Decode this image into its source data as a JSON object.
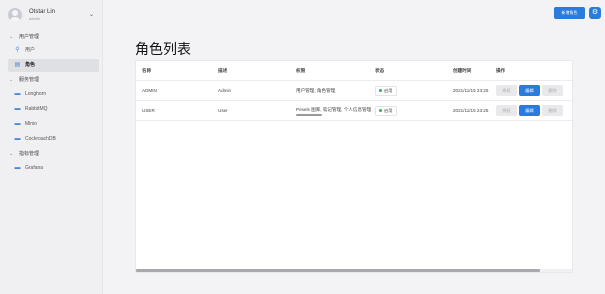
{
  "sidebar": {
    "user": {
      "name": "Otstar Lin",
      "role": "admin"
    },
    "groups": [
      {
        "label": "用户管理",
        "items": [
          {
            "label": "用户",
            "active": false
          },
          {
            "label": "角色",
            "active": true
          }
        ]
      },
      {
        "label": "服务管理",
        "items": [
          {
            "label": "Longhorn"
          },
          {
            "label": "RabbitMQ"
          },
          {
            "label": "Minio"
          },
          {
            "label": "CockroachDB"
          }
        ]
      },
      {
        "label": "指标管理",
        "items": [
          {
            "label": "Grafana"
          }
        ]
      }
    ]
  },
  "toolbar": {
    "add_label": "新增角色",
    "settings_icon": "gear-icon"
  },
  "page": {
    "title": "角色列表"
  },
  "table": {
    "columns": [
      "名称",
      "描述",
      "权限",
      "状态",
      "创建时间",
      "操作"
    ],
    "rows": [
      {
        "name": "ADMIN",
        "desc": "Admin",
        "perms": "用户管理, 角色管理",
        "status": "启用",
        "created": "2021/11/15 23:25",
        "actions": [
          "授权",
          "编辑",
          "删除"
        ]
      },
      {
        "name": "USER",
        "desc": "User",
        "perms": "Pexels 图库, 笔记管理, 个人信息管理",
        "status": "启用",
        "created": "2021/11/15 23:25",
        "actions": [
          "授权",
          "编辑",
          "删除"
        ]
      }
    ]
  },
  "colors": {
    "accent": "#2a7bde",
    "status_enabled": "#38b24a"
  }
}
